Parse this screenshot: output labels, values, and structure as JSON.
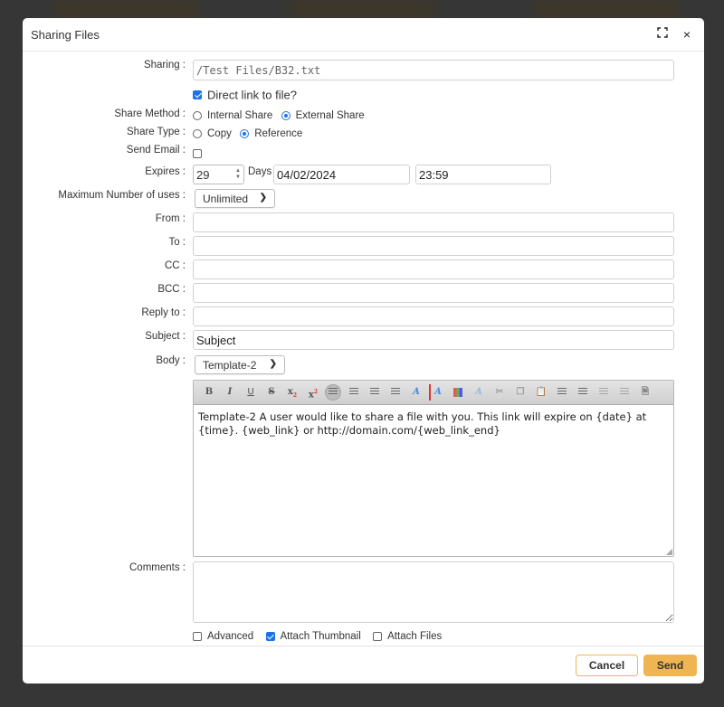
{
  "dialog": {
    "title": "Sharing Files",
    "maximize_icon": "maximize-icon",
    "close_icon": "close-icon",
    "close_glyph": "×"
  },
  "form": {
    "sharing": {
      "label": "Sharing :",
      "value": "/Test Files/B32.txt"
    },
    "direct_link": {
      "label": "Direct link to file?",
      "checked": true
    },
    "share_method": {
      "label": "Share Method :",
      "options": [
        "Internal Share",
        "External Share"
      ],
      "selected": "External Share"
    },
    "share_type": {
      "label": "Share Type :",
      "options": [
        "Copy",
        "Reference"
      ],
      "selected": "Reference"
    },
    "send_email": {
      "label": "Send Email :",
      "checked": false
    },
    "expires": {
      "label": "Expires :",
      "days": "29",
      "days_label": "Days",
      "date": "04/02/2024",
      "time": "23:59"
    },
    "max_uses": {
      "label": "Maximum Number of uses :",
      "value": "Unlimited"
    },
    "from": {
      "label": "From :",
      "value": ""
    },
    "to": {
      "label": "To :",
      "value": ""
    },
    "cc": {
      "label": "CC :",
      "value": ""
    },
    "bcc": {
      "label": "BCC :",
      "value": ""
    },
    "reply_to": {
      "label": "Reply to :",
      "value": ""
    },
    "subject": {
      "label": "Subject :",
      "value": "Subject"
    },
    "body": {
      "label": "Body :",
      "template": "Template-2",
      "content": "Template-2 A user would like to share a file with you. This link will expire on {date} at {time}. {web_link} or http://domain.com/{web_link_end}"
    },
    "comments": {
      "label": "Comments :",
      "value": ""
    },
    "advanced": {
      "label": "Advanced",
      "checked": false
    },
    "attach_thumbnail": {
      "label": "Attach Thumbnail",
      "checked": true
    },
    "attach_files": {
      "label": "Attach Files",
      "checked": false
    }
  },
  "toolbar": {
    "bold": "B",
    "italic": "I",
    "underline": "U",
    "strike": "S",
    "subscript": "x",
    "superscript": "x",
    "font_color": "A",
    "bg_color": "A"
  },
  "footer": {
    "cancel": "Cancel",
    "send": "Send"
  },
  "colors": {
    "accent": "#f0b552",
    "checkbox": "#1a73e8"
  }
}
